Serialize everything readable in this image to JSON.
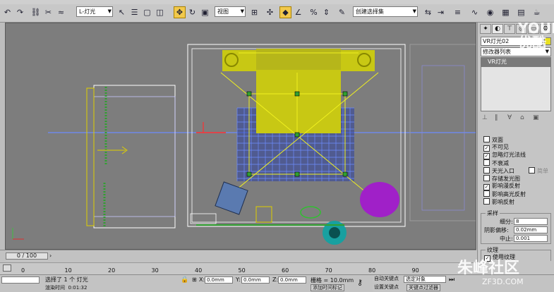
{
  "toolbar": {
    "selection_filter": "L-灯光",
    "coord_system": "视图",
    "named_selection": "创建选择集"
  },
  "watermarks": {
    "youku": "YOUKU 优酷",
    "site": "朱峰社区",
    "site_url": "ZF3D.COM"
  },
  "viewport": {
    "grid_color": "#6e8cff",
    "light_color": "#f0f020",
    "bed_color": "#c8c814",
    "plant_color": "#a020c8",
    "teal_color": "#18a0a0"
  },
  "command_panel": {
    "object_name": "VR灯光02",
    "modifier_list": "修改器列表",
    "stack_item": "VR灯光",
    "options": [
      {
        "label": "双面",
        "checked": false
      },
      {
        "label": "不可见",
        "checked": true
      },
      {
        "label": "忽略灯光法线",
        "checked": true
      },
      {
        "label": "不衰减",
        "checked": false
      },
      {
        "label": "天光入口",
        "checked": false
      },
      {
        "label": "存储发光图",
        "checked": false
      },
      {
        "label": "影响漫反射",
        "checked": true
      },
      {
        "label": "影响高光反射",
        "checked": false
      },
      {
        "label": "影响反射",
        "checked": false
      }
    ],
    "simple_label": "简单",
    "sampling": {
      "title": "采样",
      "subdivs_label": "细分:",
      "subdivs_value": "8",
      "shadow_bias_label": "阴影偏移:",
      "shadow_bias_value": "0.02mm",
      "cutoff_label": "中止:",
      "cutoff_value": "0.001"
    },
    "texture": {
      "title": "纹理",
      "use_texture_label": "使用纹理",
      "use_texture_checked": true
    }
  },
  "timeline": {
    "frame_counter": "0 / 100",
    "ticks": [
      "0",
      "10",
      "20",
      "30",
      "40",
      "50",
      "60",
      "70",
      "80",
      "90"
    ]
  },
  "status": {
    "selection_text": "选择了 1 个 灯光",
    "render_time_label": "渲染时间",
    "render_time_value": "0:01:32",
    "x_label": "X:",
    "x_value": "0.0mm",
    "y_label": "Y:",
    "y_value": "0.0mm",
    "z_label": "Z:",
    "z_value": "0.0mm",
    "grid_text": "栅格 = 10.0mm",
    "add_time_tag": "添加时间标记",
    "auto_key": "自动关键点",
    "set_key": "设置关键点",
    "selected_objects": "选定对象",
    "key_filters": "关键点过滤器"
  }
}
